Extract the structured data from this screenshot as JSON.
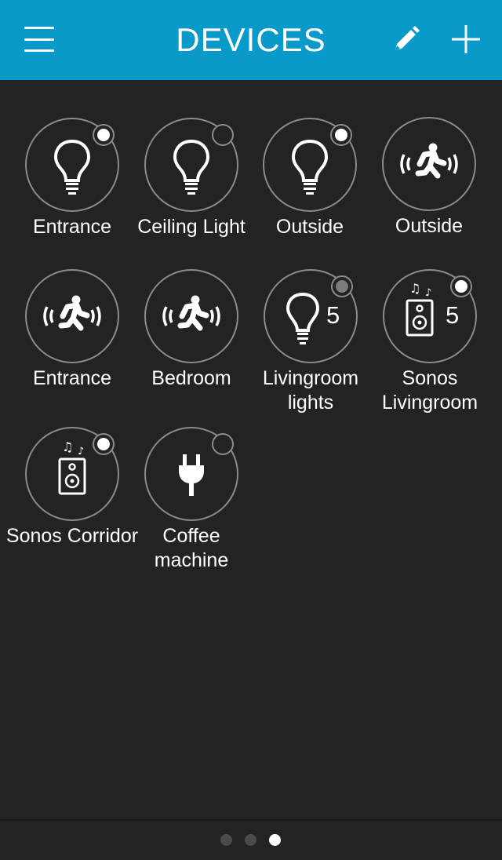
{
  "header": {
    "title": "DEVICES",
    "background_color": "#0a9ac9",
    "menu_icon": "hamburger-menu-icon",
    "edit_icon": "pencil-icon",
    "add_icon": "plus-icon"
  },
  "devices": [
    {
      "label": "Entrance",
      "icon": "lightbulb-icon",
      "status": "on"
    },
    {
      "label": "Ceiling Light",
      "icon": "lightbulb-icon",
      "status": "off"
    },
    {
      "label": "Outside",
      "icon": "lightbulb-icon",
      "status": "on"
    },
    {
      "label": "Outside",
      "icon": "motion-sensor-icon",
      "status": "none"
    },
    {
      "label": "Entrance",
      "icon": "motion-sensor-icon",
      "status": "none"
    },
    {
      "label": "Bedroom",
      "icon": "motion-sensor-icon",
      "status": "none"
    },
    {
      "label": "Livingroom lights",
      "icon": "lightbulb-icon",
      "count": "5",
      "status": "partial"
    },
    {
      "label": "Sonos Livingroom",
      "icon": "speaker-icon",
      "count": "5",
      "status": "on"
    },
    {
      "label": "Sonos Corridor",
      "icon": "speaker-icon",
      "status": "on"
    },
    {
      "label": "Coffee machine",
      "icon": "plug-icon",
      "status": "off"
    }
  ],
  "pager": {
    "pages": 3,
    "current": 3
  },
  "colors": {
    "background": "#222325",
    "ring": "#8a8b8d",
    "indicator_on": "#ffffff",
    "indicator_partial": "#7b7c7e"
  }
}
